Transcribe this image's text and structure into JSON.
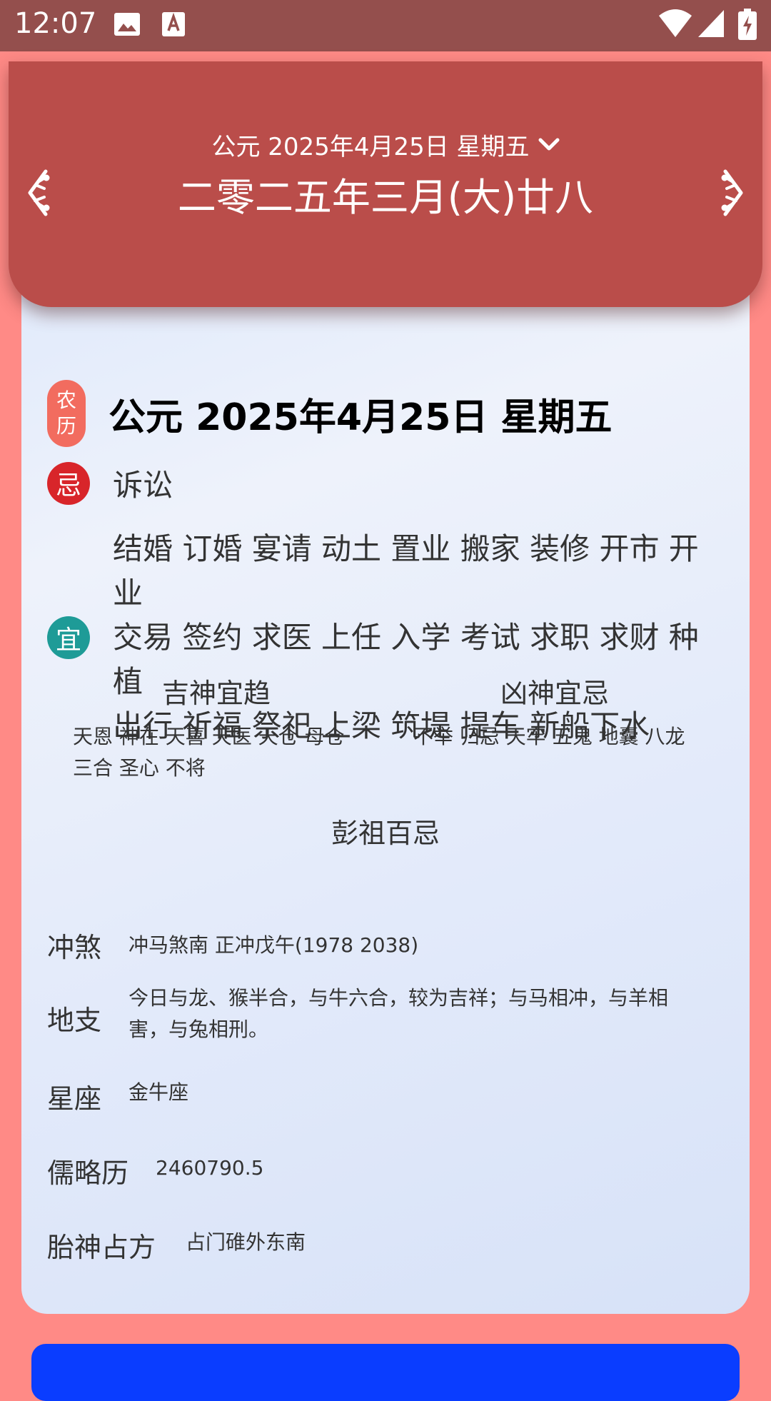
{
  "status_bar": {
    "time": "12:07"
  },
  "header": {
    "selected_date": "公元 2025年4月25日 星期五",
    "lunar_date": "二零二五年三月(大)廿八"
  },
  "detail": {
    "lunar_badge": [
      "农",
      "历"
    ],
    "date_title": "公元 2025年4月25日 星期五",
    "avoid_badge": "忌",
    "avoid_text": "诉讼",
    "suitable_badge": "宜",
    "suitable_lines": [
      "结婚 订婚 宴请 动土 置业 搬家 装修 开市 开业",
      "交易 签约 求医 上任 入学 考试 求职 求财 种植",
      "出行 祈福 祭祀 上梁 筑堤 提车 新船下水"
    ],
    "lucky_gods_title": "吉神宜趋",
    "lucky_gods_lines": [
      "天恩 神在 天喜 天医 天仓 母仓",
      "三合 圣心 不将"
    ],
    "evil_gods_title": "凶神宜忌",
    "evil_gods_lines": [
      "不举 归忌 天牢 五鬼 地囊 八龙"
    ],
    "pengzu_title": "彭祖百忌",
    "info": [
      {
        "label": "冲煞",
        "value": "冲马煞南 正冲戊午(1978 2038)"
      },
      {
        "label": "地支",
        "value": "今日与龙、猴半合，与牛六合，较为吉祥；与马相冲，与羊相害，与兔相刑。"
      },
      {
        "label": "星座",
        "value": "金牛座"
      },
      {
        "label": "儒略历",
        "value": "2460790.5"
      },
      {
        "label": "胎神占方",
        "value": "占门碓外东南"
      }
    ]
  },
  "colors": {
    "page_background": "#ff8a86",
    "header_background": "#ba4d4a",
    "lunar_badge": "#f26c5f",
    "avoid_badge": "#d8252a",
    "suitable_badge": "#1e9b97",
    "bottom_button": "#0a3dff"
  },
  "icons": {
    "status_left": [
      "image-icon",
      "font-download-icon"
    ],
    "status_right": [
      "wifi-icon",
      "cellular-signal-icon",
      "battery-charging-icon"
    ],
    "header": [
      "chevron-down-icon",
      "previous-day-icon",
      "next-day-icon"
    ]
  }
}
